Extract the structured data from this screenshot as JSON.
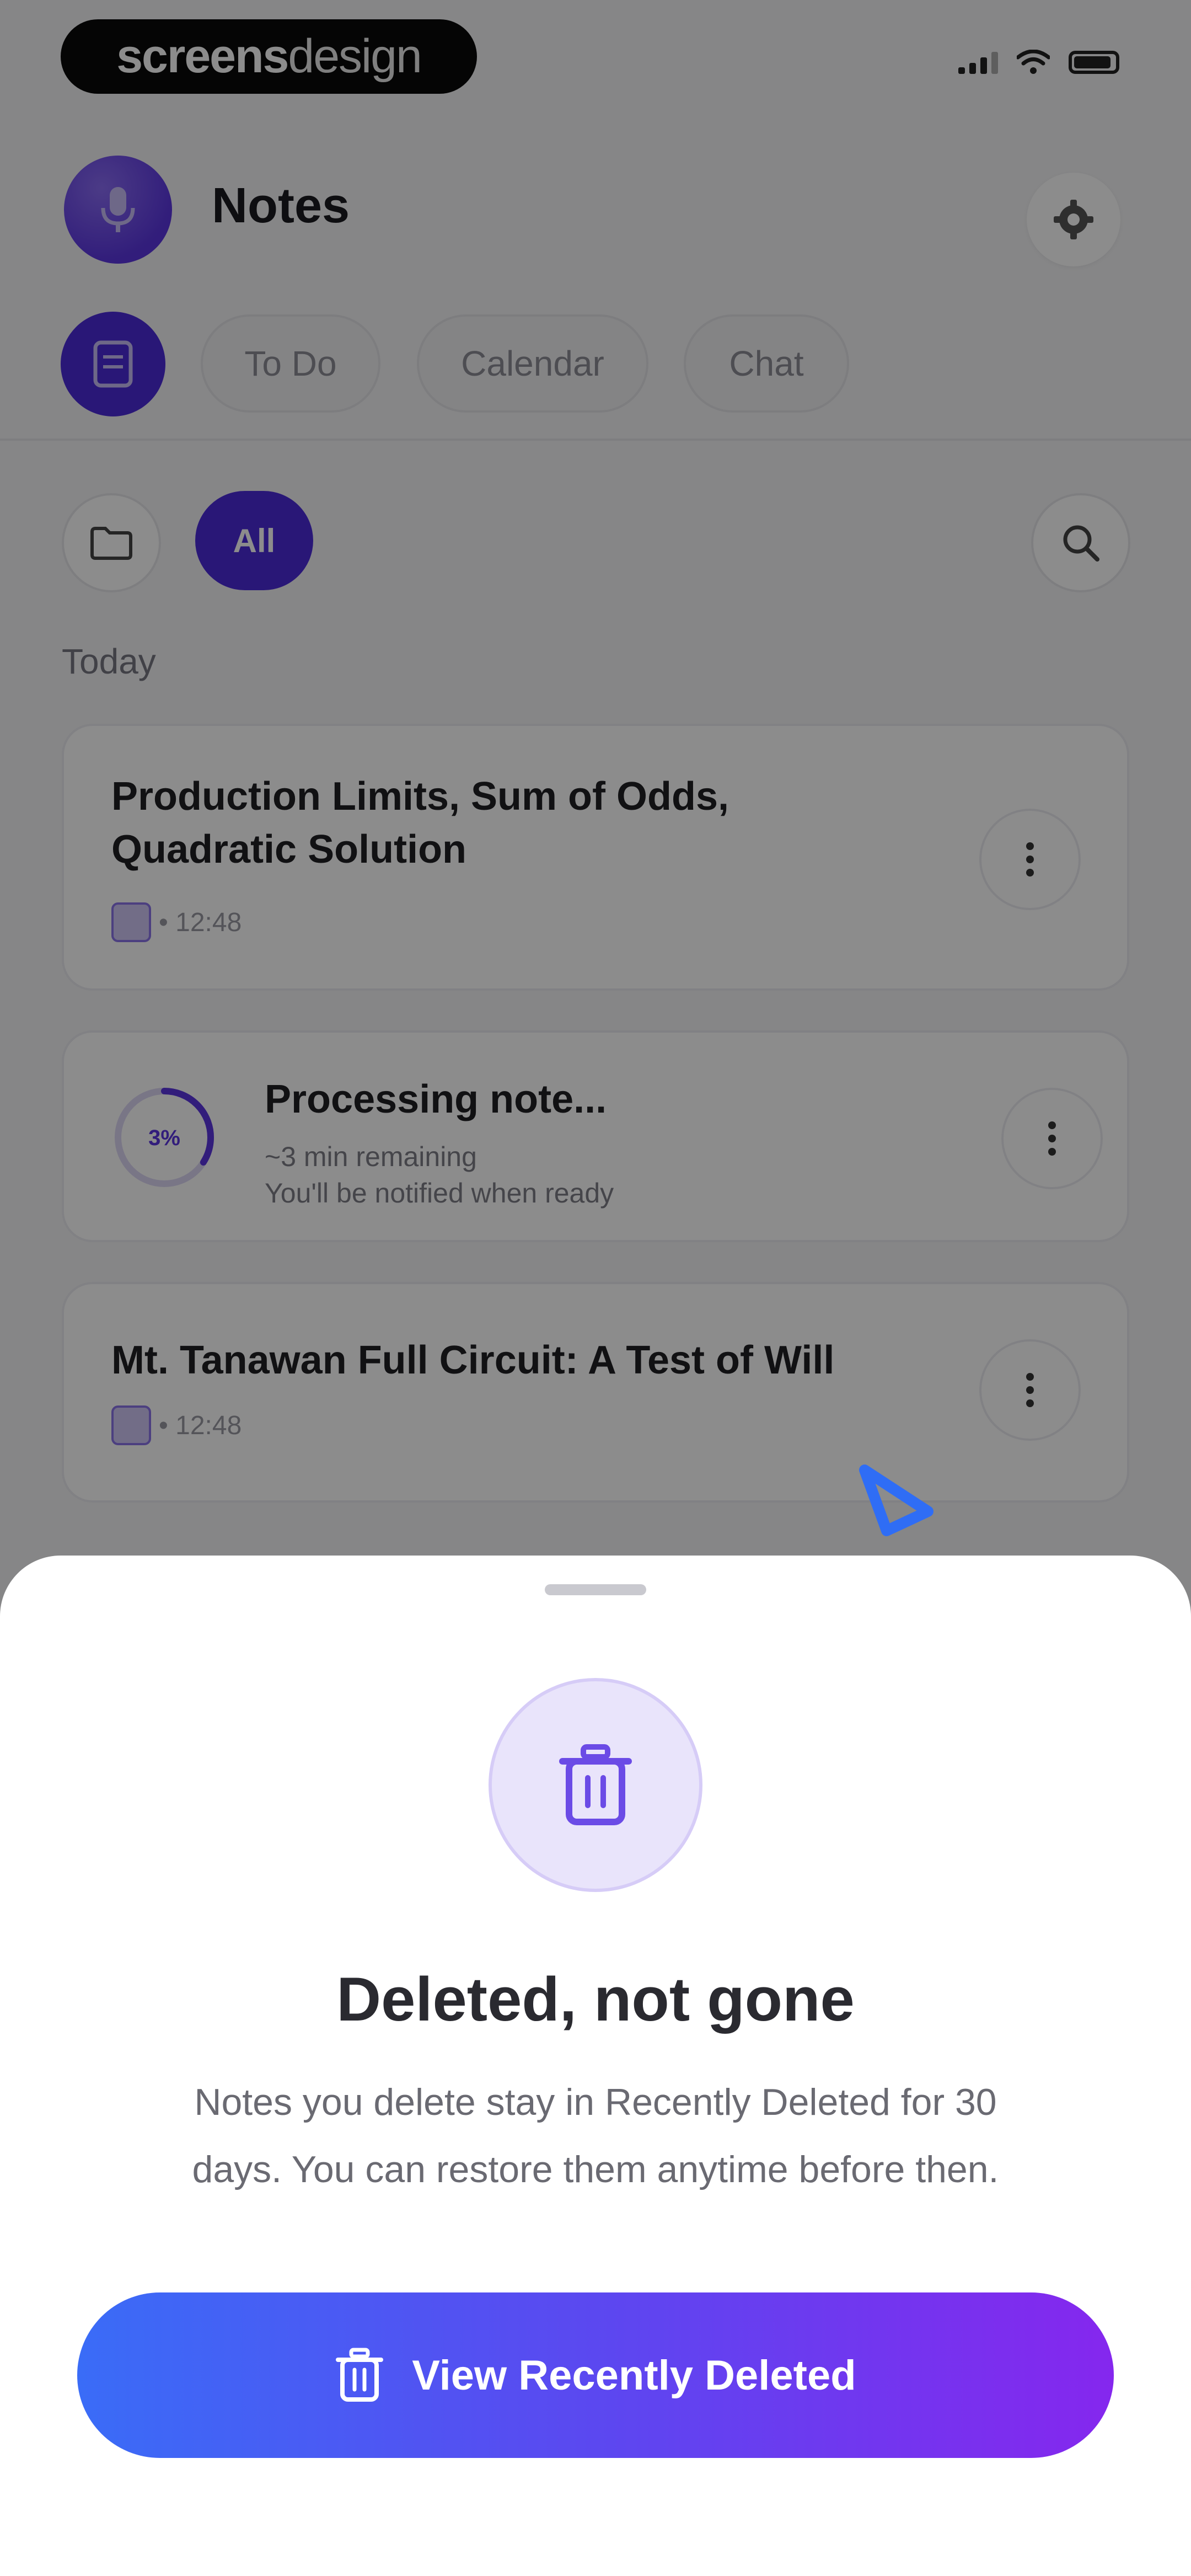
{
  "status_bar": {
    "brand_bold": "screens",
    "brand_light": "design",
    "icons": [
      "signal-icon",
      "wifi-icon",
      "battery-icon"
    ]
  },
  "header": {
    "title": "Notes",
    "avatar_icon": "microphone-icon",
    "settings_icon": "gear-icon"
  },
  "mode_tabs": [
    {
      "label": "To Do"
    },
    {
      "label": "Calendar"
    },
    {
      "label": "Chat"
    }
  ],
  "filters": {
    "active_chip": "All",
    "folder_icon": "folder-icon",
    "search_icon": "search-icon"
  },
  "section": {
    "label": "Today"
  },
  "notes": [
    {
      "title_line1": "Production Limits, Sum of Odds,",
      "title_line2": "Quadratic Solution",
      "meta": "• 12:48"
    },
    {
      "title": "Processing note...",
      "progress_label": "3%",
      "progress_fraction": 0.34,
      "line1": "~3 min remaining",
      "line2": "You'll be notified when ready"
    },
    {
      "title": "Mt. Tanawan Full Circuit: A Test of Will",
      "meta": "• 12:48"
    }
  ],
  "sheet": {
    "icon": "trash-icon",
    "title": "Deleted, not gone",
    "body_line1": "Notes you delete stay in Recently Deleted for 30",
    "body_line2": "days. You can restore them anytime before then.",
    "cta_label": "View Recently Deleted"
  },
  "colors": {
    "accent": "#4c2bd9",
    "gradient_start": "#3a6cf7",
    "gradient_end": "#8527ee",
    "icon_tint": "#6b4be6"
  }
}
